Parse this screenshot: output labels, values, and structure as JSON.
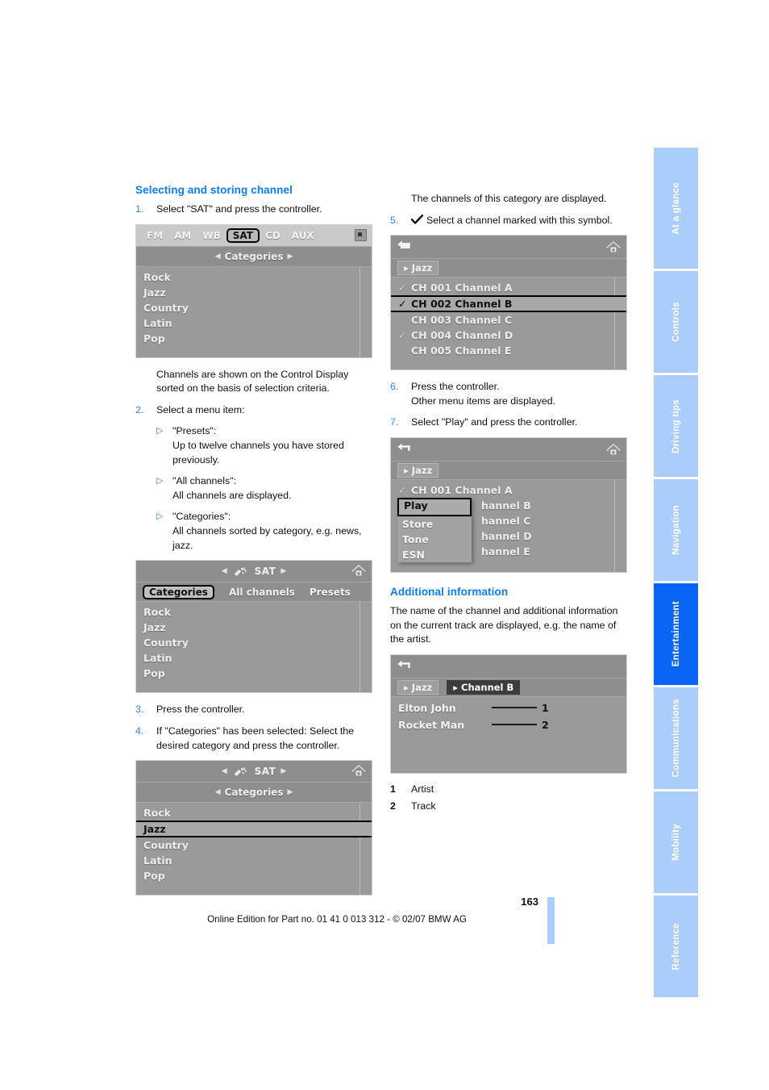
{
  "document": {
    "page_number": "163",
    "edition_line": "Online Edition for Part no. 01 41 0 013 312 - © 02/07 BMW AG"
  },
  "side_tabs": [
    {
      "label": "At a glance",
      "active": false
    },
    {
      "label": "Controls",
      "active": false
    },
    {
      "label": "Driving tips",
      "active": false
    },
    {
      "label": "Navigation",
      "active": false
    },
    {
      "label": "Entertainment",
      "active": true
    },
    {
      "label": "Communications",
      "active": false
    },
    {
      "label": "Mobility",
      "active": false
    },
    {
      "label": "Reference",
      "active": false
    }
  ],
  "colors": {
    "heading_blue": "#0a7ef5",
    "step_blue": "#2b8cf0",
    "tab_inactive": "#aacdfb",
    "tab_active": "#0a64f5"
  },
  "left_column": {
    "heading": "Selecting and storing channel",
    "step1": {
      "num": "1.",
      "text": "Select \"SAT\" and press the controller."
    },
    "figure1": {
      "sources": [
        "FM",
        "AM",
        "WB",
        "SAT",
        "CD",
        "AUX"
      ],
      "selected_source": "SAT",
      "title": "Categories",
      "items": [
        "Rock",
        "Jazz",
        "Country",
        "Latin",
        "Pop"
      ],
      "sd_icon": "sd-card-icon"
    },
    "caption1": "Channels are shown on the Control Display sorted on the basis of selection criteria.",
    "step2": {
      "num": "2.",
      "text": "Select a menu item:"
    },
    "bullets": [
      {
        "marker": "triangle-right-icon",
        "title": "\"Presets\":",
        "text": "Up to twelve channels you have stored previously."
      },
      {
        "marker": "triangle-right-icon",
        "title": "\"All channels\":",
        "text": "All channels are displayed."
      },
      {
        "marker": "triangle-right-icon",
        "title": "\"Categories\":",
        "text": "All channels sorted by category, e.g. news, jazz."
      }
    ],
    "figure2": {
      "header_title": "SAT",
      "tabs": [
        "Categories",
        "All channels",
        "Presets"
      ],
      "selected_tab": "Categories",
      "items": [
        "Rock",
        "Jazz",
        "Country",
        "Latin",
        "Pop"
      ],
      "home_icon": "home-icon",
      "sat_icon": "satellite-icon"
    },
    "step3": {
      "num": "3.",
      "text": "Press the controller."
    },
    "step4": {
      "num": "4.",
      "text": "If \"Categories\" has been selected: Select the desired category and press the controller."
    },
    "figure3": {
      "header_title": "SAT",
      "sub_title": "Categories",
      "items": [
        "Rock",
        "Jazz",
        "Country",
        "Latin",
        "Pop"
      ],
      "selected_item": "Jazz",
      "home_icon": "home-icon",
      "sat_icon": "satellite-icon"
    }
  },
  "right_column": {
    "intro": "The channels of this category are displayed.",
    "step5": {
      "num": "5.",
      "text": "Select a channel marked with this symbol.",
      "symbol": "checkmark-icon"
    },
    "figure4": {
      "back_icon": "back-arrow-icon",
      "home_icon": "home-icon",
      "breadcrumb": "Jazz",
      "rows": [
        {
          "check": true,
          "label": "CH 001 Channel A",
          "selected": false
        },
        {
          "check": true,
          "label": "CH 002 Channel B",
          "selected": true
        },
        {
          "check": false,
          "label": "CH 003 Channel C",
          "selected": false
        },
        {
          "check": true,
          "label": "CH 004 Channel D",
          "selected": false
        },
        {
          "check": false,
          "label": "CH 005 Channel E",
          "selected": false
        }
      ]
    },
    "step6": {
      "num": "6.",
      "line1": "Press the controller.",
      "line2": "Other menu items are displayed."
    },
    "step7": {
      "num": "7.",
      "text": "Select \"Play\" and press the controller."
    },
    "figure5": {
      "back_icon": "back-arrow-icon",
      "home_icon": "home-icon",
      "breadcrumb": "Jazz",
      "rows": [
        {
          "check": true,
          "label": "CH 001 Channel A"
        },
        {
          "check": false,
          "label": "hannel B"
        },
        {
          "check": false,
          "label": "hannel C"
        },
        {
          "check": false,
          "label": "hannel D"
        },
        {
          "check": false,
          "label": "hannel E"
        }
      ],
      "popup_items": [
        "Play",
        "Store",
        "Tone",
        "ESN"
      ],
      "popup_selected": "Play"
    },
    "additional_heading": "Additional information",
    "additional_text": "The name of the channel and additional information on the current track are displayed, e.g. the name of the artist.",
    "figure6": {
      "back_icon": "back-arrow-icon",
      "breadcrumbs": [
        "Jazz",
        "Channel B"
      ],
      "selected_breadcrumb": "Channel B",
      "rows": [
        {
          "text": "Elton John",
          "index": "1"
        },
        {
          "text": "Rocket Man",
          "index": "2"
        }
      ]
    },
    "legend": [
      {
        "key": "1",
        "value": "Artist"
      },
      {
        "key": "2",
        "value": "Track"
      }
    ]
  }
}
